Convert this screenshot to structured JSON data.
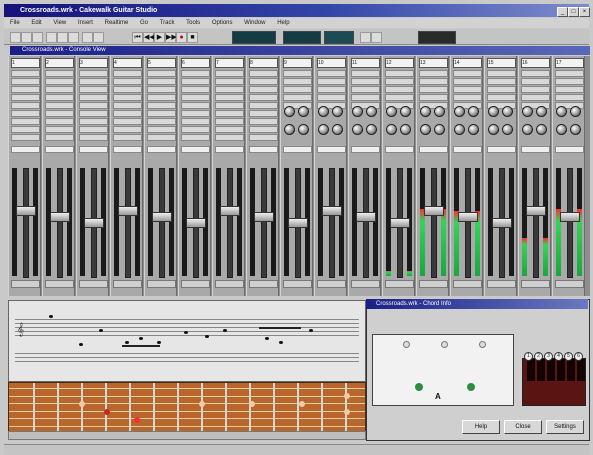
{
  "window": {
    "title": "Crossroads.wrk - Cakewalk Guitar Studio",
    "buttons": [
      "_",
      "□",
      "×"
    ]
  },
  "menubar": [
    "File",
    "Edit",
    "View",
    "Insert",
    "Realtime",
    "Go",
    "Track",
    "Tools",
    "Options",
    "Window",
    "Help"
  ],
  "toolbar": {
    "transport": [
      "⏮",
      "◀◀",
      "▶",
      "▶▶",
      "●",
      "■"
    ]
  },
  "console": {
    "title": "Crossroads.wrk - Console View",
    "channels": [
      {
        "name": "1",
        "level": 0
      },
      {
        "name": "2",
        "level": 0
      },
      {
        "name": "3",
        "level": 0
      },
      {
        "name": "4",
        "level": 0
      },
      {
        "name": "5",
        "level": 0
      },
      {
        "name": "6",
        "level": 0
      },
      {
        "name": "7",
        "level": 0
      },
      {
        "name": "8",
        "level": 0
      },
      {
        "name": "9",
        "level": 0
      },
      {
        "name": "10",
        "level": 0
      },
      {
        "name": "11",
        "level": 0
      },
      {
        "name": "12",
        "level": 0.05
      },
      {
        "name": "13",
        "level": 0.62
      },
      {
        "name": "14",
        "level": 0.6
      },
      {
        "name": "15",
        "level": 0
      },
      {
        "name": "16",
        "level": 0.35
      },
      {
        "name": "17",
        "level": 0.62
      }
    ]
  },
  "chord_dialog": {
    "title": "Crossroads.wrk - Chord Info",
    "chord_name": "A",
    "buttons": [
      "Help",
      "Close",
      "Settings"
    ],
    "piano_numbers": [
      "1",
      "2",
      "3",
      "4",
      "5",
      "6"
    ]
  },
  "colors": {
    "titlebar": "#15127a",
    "fretboard": "#b8672c",
    "meter_green": "#37d25b",
    "meter_red": "#ff2d2d"
  }
}
